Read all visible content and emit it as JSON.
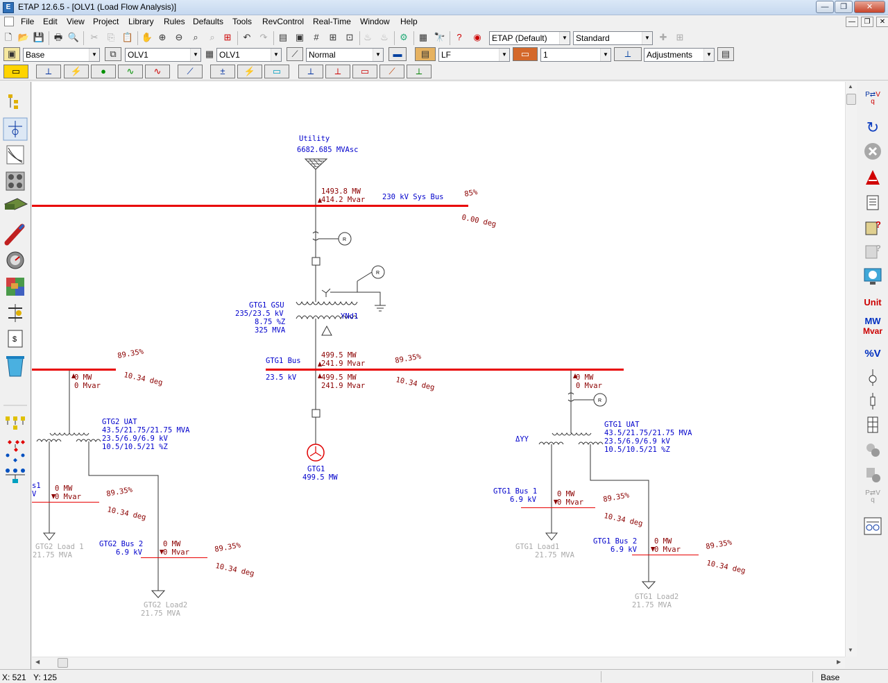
{
  "window": {
    "title": "ETAP 12.6.5 - [OLV1 (Load Flow Analysis)]",
    "minimize": "—",
    "maximize": "❐",
    "close": "✕"
  },
  "menu": [
    "File",
    "Edit",
    "View",
    "Project",
    "Library",
    "Rules",
    "Defaults",
    "Tools",
    "RevControl",
    "Real-Time",
    "Window",
    "Help"
  ],
  "toolbar1": {
    "config_combo": "ETAP (Default)",
    "standard_combo": "Standard"
  },
  "toolbar2": {
    "presentation": "Base",
    "olv_combo_1": "OLV1",
    "olv_combo_2": "OLV1",
    "mode_combo": "Normal",
    "study_case": "LF",
    "page_combo": "1",
    "adjustments_combo": "Adjustments"
  },
  "diagram": {
    "utility": {
      "name": "Utility",
      "rating": "6682.685 MVAsc"
    },
    "sys_bus": {
      "name": "230 kV Sys Bus",
      "percent": "85%",
      "angle": "0.00 deg",
      "flow_mw": "1493.8 MW",
      "flow_mvar": "414.2 Mvar"
    },
    "gsu": {
      "name": "GTG1 GSU",
      "kv": "235/23.5 kV",
      "z": "8.75 %Z",
      "mva": "325 MVA",
      "vector": "YNd1"
    },
    "gtg1_bus": {
      "name": "GTG1 Bus",
      "kv": "23.5 kV",
      "percent": "89.35%",
      "angle": "10.34 deg",
      "up_mw": "499.5 MW",
      "up_mvar": "241.9 Mvar",
      "down_mw": "499.5 MW",
      "down_mvar": "241.9 Mvar"
    },
    "gtg1_gen": {
      "name": "GTG1",
      "mw": "499.5 MW"
    },
    "left_bus": {
      "percent": "89.35%",
      "angle": "10.34 deg",
      "mw": "0 MW",
      "mvar": "0 Mvar"
    },
    "gtg2_uat": {
      "name": "GTG2 UAT",
      "mva": "43.5/21.75/21.75 MVA",
      "kv": "23.5/6.9/6.9 kV",
      "z": "10.5/10.5/21 %Z"
    },
    "gtg2_bus1": {
      "name_frag": "s1",
      "kv_frag": "V",
      "mw": "0 MW",
      "mvar": "0 Mvar",
      "percent": "89.35%",
      "angle": "10.34 deg"
    },
    "gtg2_load1": {
      "name": "GTG2 Load 1",
      "mva": "21.75 MVA"
    },
    "gtg2_bus2": {
      "name": "GTG2 Bus 2",
      "kv": "6.9 kV",
      "mw": "0 MW",
      "mvar": "0 Mvar",
      "percent": "89.35%",
      "angle": "10.34 deg"
    },
    "gtg2_load2": {
      "name": "GTG2 Load2",
      "mva": "21.75 MVA"
    },
    "right_tap": {
      "mw": "0 MW",
      "mvar": "0 Mvar"
    },
    "gtg1_uat": {
      "name": "GTG1 UAT",
      "mva": "43.5/21.75/21.75 MVA",
      "kv": "23.5/6.9/6.9 kV",
      "z": "10.5/10.5/21 %Z",
      "vector": "ΔYY"
    },
    "gtg1_bus1": {
      "name": "GTG1 Bus 1",
      "kv": "6.9 kV",
      "mw": "0 MW",
      "mvar": "0 Mvar",
      "percent": "89.35%",
      "angle": "10.34 deg"
    },
    "gtg1_load1": {
      "name": "GTG1 Load1",
      "mva": "21.75 MVA"
    },
    "gtg1_bus2": {
      "name": "GTG1 Bus 2",
      "kv": "6.9 kV",
      "mw": "0 MW",
      "mvar": "0 Mvar",
      "percent": "89.35%",
      "angle": "10.34 deg"
    },
    "gtg1_load2": {
      "name": "GTG1 Load2",
      "mva": "21.75 MVA"
    },
    "relay": "R"
  },
  "righttool": {
    "unit": "Unit",
    "mw": "MW",
    "mvar": "Mvar",
    "pctv": "%V",
    "pv1": "P",
    "pv2": "V",
    "pv3": "q"
  },
  "status": {
    "x": "X: 521",
    "y": "Y: 125",
    "presentation": "Base"
  },
  "colors": {
    "bus": "#e80000",
    "label_blue": "#0000cc",
    "result_red": "#8b0000",
    "load_gray": "#a8a8a8"
  }
}
